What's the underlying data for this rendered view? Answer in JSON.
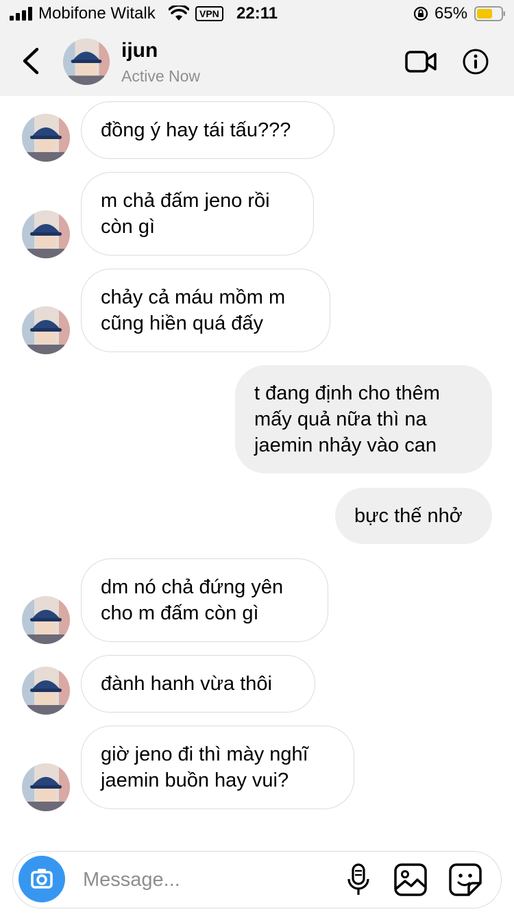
{
  "status_bar": {
    "carrier": "Mobifone Witalk",
    "vpn": "VPN",
    "time": "22:11",
    "battery_percent": "65%",
    "battery_level": 0.65,
    "battery_color": "#f5c400"
  },
  "header": {
    "name": "ijun",
    "status": "Active Now",
    "icons": [
      "back-chevron-icon",
      "video-camera-icon",
      "info-icon"
    ]
  },
  "messages": [
    {
      "sender": "them",
      "text": "đồng ý hay tái tấu???"
    },
    {
      "sender": "them",
      "text": "m chả đấm jeno rồi\ncòn gì"
    },
    {
      "sender": "them",
      "text": "chảy cả máu mồm m\ncũng hiền quá đấy"
    },
    {
      "sender": "me",
      "text": "t đang định cho thêm\nmấy quả nữa thì na\njaemin nhảy vào can"
    },
    {
      "sender": "me",
      "text": "bực thế nhở"
    },
    {
      "sender": "them",
      "text": "dm nó chả đứng yên\ncho m đấm còn gì"
    },
    {
      "sender": "them",
      "text": "đành hanh vừa thôi"
    },
    {
      "sender": "them",
      "text": "giờ jeno đi thì mày nghĩ\njaemin buồn hay vui?"
    }
  ],
  "composer": {
    "placeholder": "Message...",
    "accent": "#3797f0",
    "icons": [
      "camera-icon",
      "microphone-icon",
      "gallery-icon",
      "sticker-icon"
    ]
  }
}
